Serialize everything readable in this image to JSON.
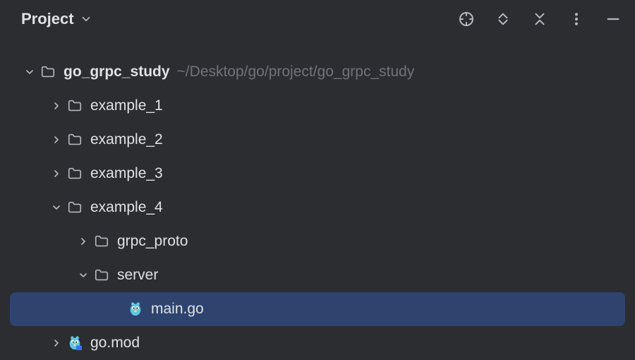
{
  "header": {
    "title": "Project"
  },
  "icons": {
    "folder": "folder-icon",
    "go_file": "go-file-icon",
    "go_mod": "go-mod-icon"
  },
  "tree": {
    "root": {
      "name": "go_grpc_study",
      "path": "~/Desktop/go/project/go_grpc_study",
      "expanded": true,
      "children": [
        {
          "name": "example_1",
          "type": "folder",
          "expanded": false
        },
        {
          "name": "example_2",
          "type": "folder",
          "expanded": false
        },
        {
          "name": "example_3",
          "type": "folder",
          "expanded": false
        },
        {
          "name": "example_4",
          "type": "folder",
          "expanded": true,
          "children": [
            {
              "name": "grpc_proto",
              "type": "folder",
              "expanded": false
            },
            {
              "name": "server",
              "type": "folder",
              "expanded": true,
              "children": [
                {
                  "name": "main.go",
                  "type": "go_file",
                  "selected": true
                }
              ]
            }
          ]
        },
        {
          "name": "go.mod",
          "type": "go_mod",
          "expanded": false
        }
      ]
    }
  }
}
